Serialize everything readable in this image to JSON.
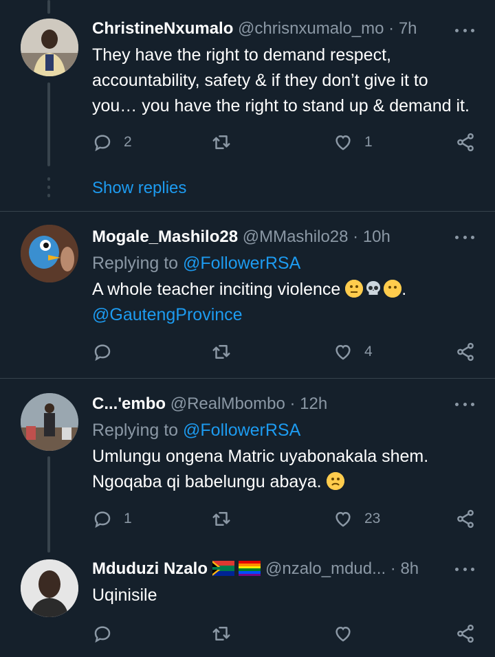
{
  "tweets": [
    {
      "name": "ChristineNxumalo",
      "handle": "@chrisnxumalo_mo",
      "time": "· 7h",
      "text_lines": [
        "They have the right to demand respect,",
        "accountability, safety & if they don’t give it to",
        "you… you have the right to stand up & demand it."
      ],
      "reply_count": "2",
      "retweet_count": "",
      "like_count": "1",
      "show_replies": "Show replies"
    },
    {
      "name": "Mogale_Mashilo28",
      "handle": "@MMashilo28",
      "time": "· 10h",
      "replying_prefix": "Replying to",
      "replying_to": "@FollowerRSA",
      "text": "A whole teacher inciting violence",
      "text_suffix": ".",
      "mention": "@GautengProvince",
      "reply_count": "",
      "retweet_count": "",
      "like_count": "4"
    },
    {
      "name": "C...'embo",
      "handle": "@RealMbombo",
      "time": "· 12h",
      "replying_prefix": "Replying to",
      "replying_to": "@FollowerRSA",
      "text_lines": [
        "Umlungu ongena Matric uyabonakala shem.",
        "Ngoqaba qi babelungu abaya."
      ],
      "reply_count": "1",
      "retweet_count": "",
      "like_count": "23"
    },
    {
      "name": "Mduduzi Nzalo",
      "handle": "@nzalo_mdud...",
      "time": "· 8h",
      "text": "Uqinisile",
      "reply_count": "",
      "retweet_count": "",
      "like_count": ""
    }
  ],
  "icons": {
    "reply": "reply-icon",
    "retweet": "retweet-icon",
    "like": "heart-icon",
    "share": "share-icon",
    "more": "more-icon"
  },
  "colors": {
    "background": "#15202b",
    "link": "#1d9bf0",
    "muted": "#8b98a5",
    "divider": "#38444d"
  }
}
